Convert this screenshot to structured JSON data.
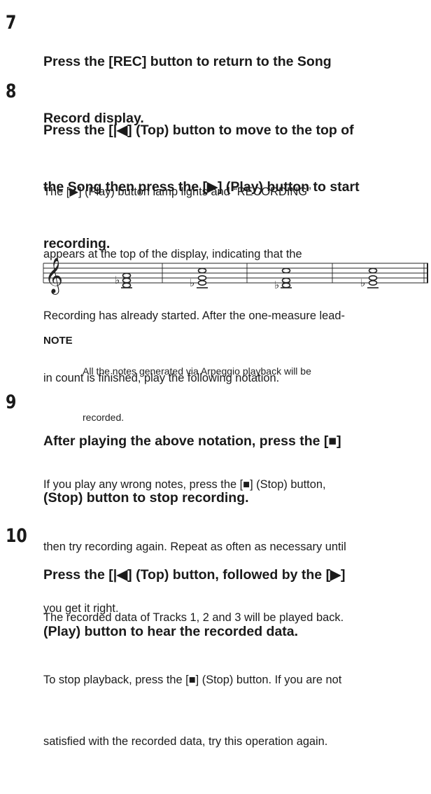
{
  "steps": [
    {
      "number": "7",
      "heading": [
        "Press the [REC] button to return to the Song",
        "Record display."
      ],
      "body": []
    },
    {
      "number": "8",
      "heading": [
        "Press the [|◀] (Top) button to move to the top of",
        "the Song then press the [▶] (Play) button to start",
        "recording."
      ],
      "body": [
        "The [▶] (Play) button lamp lights and “RECORDING”",
        "appears at the top of the display, indicating that the",
        "Recording has already started. After the one-measure lead-",
        "in count is finished, play the following notation."
      ]
    },
    {
      "number": "9",
      "heading": [
        "After playing the above notation, press the [■]",
        "(Stop) button to stop recording."
      ],
      "body": [
        "If you play any wrong notes, press the [■] (Stop) button,",
        "then try recording again. Repeat as often as necessary until",
        "you get it right."
      ]
    },
    {
      "number": "10",
      "heading": [
        "Press the [|◀] (Top) button, followed by the [▶]",
        "(Play) button to hear the recorded data."
      ],
      "body": [
        "The recorded data of Tracks 1, 2 and 3 will be played back.",
        "To stop playback, press the [■] (Stop) button. If you are not",
        "satisfied with the recorded data, try this operation again."
      ]
    }
  ],
  "note": {
    "label": "NOTE",
    "text": [
      "All the notes generated via Arpeggio playback will be",
      "recorded."
    ]
  },
  "notation": {
    "clef": "treble-clef-icon",
    "flat_symbol": "♭",
    "measures": 4
  }
}
